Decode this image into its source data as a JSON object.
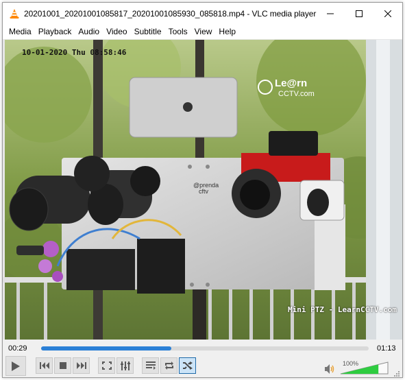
{
  "window": {
    "title": "20201001_20201001085817_20201001085930_085818.mp4 - VLC media player",
    "app_icon": "vlc-cone-icon",
    "buttons": {
      "minimize": "minimize-icon",
      "maximize": "maximize-icon",
      "close": "close-icon"
    }
  },
  "menu": {
    "items": [
      {
        "label": "Media"
      },
      {
        "label": "Playback"
      },
      {
        "label": "Audio"
      },
      {
        "label": "Video"
      },
      {
        "label": "Subtitle"
      },
      {
        "label": "Tools"
      },
      {
        "label": "View"
      },
      {
        "label": "Help"
      }
    ]
  },
  "video": {
    "osd_timestamp": "10-01-2020 Thu 08:58:46",
    "osd_caption": "Mini PTZ - LearnCCTV.com",
    "watermark_line1": "Le@rn",
    "watermark_line2": "CCTV.com",
    "device_label_line1": "@prenda",
    "device_label_line2": "cftv"
  },
  "controls": {
    "elapsed": "00:29",
    "duration": "01:13",
    "progress_fraction": 0.397,
    "volume_percent_label": "100%",
    "volume_fraction": 0.8,
    "buttons": [
      {
        "name": "play-button",
        "icon": "play-icon"
      },
      {
        "name": "previous-button",
        "icon": "skip-previous-icon"
      },
      {
        "name": "stop-button",
        "icon": "stop-icon"
      },
      {
        "name": "next-button",
        "icon": "skip-next-icon"
      },
      {
        "name": "fullscreen-button",
        "icon": "fullscreen-icon"
      },
      {
        "name": "extended-settings-button",
        "icon": "equalizer-sliders-icon"
      },
      {
        "name": "playlist-button",
        "icon": "playlist-icon"
      },
      {
        "name": "loop-button",
        "icon": "loop-icon"
      },
      {
        "name": "random-button",
        "icon": "shuffle-icon",
        "active": true
      }
    ],
    "colors": {
      "accent": "#2b80d6",
      "volume": "#2ecc40",
      "active_button": "#cce4f7"
    }
  }
}
